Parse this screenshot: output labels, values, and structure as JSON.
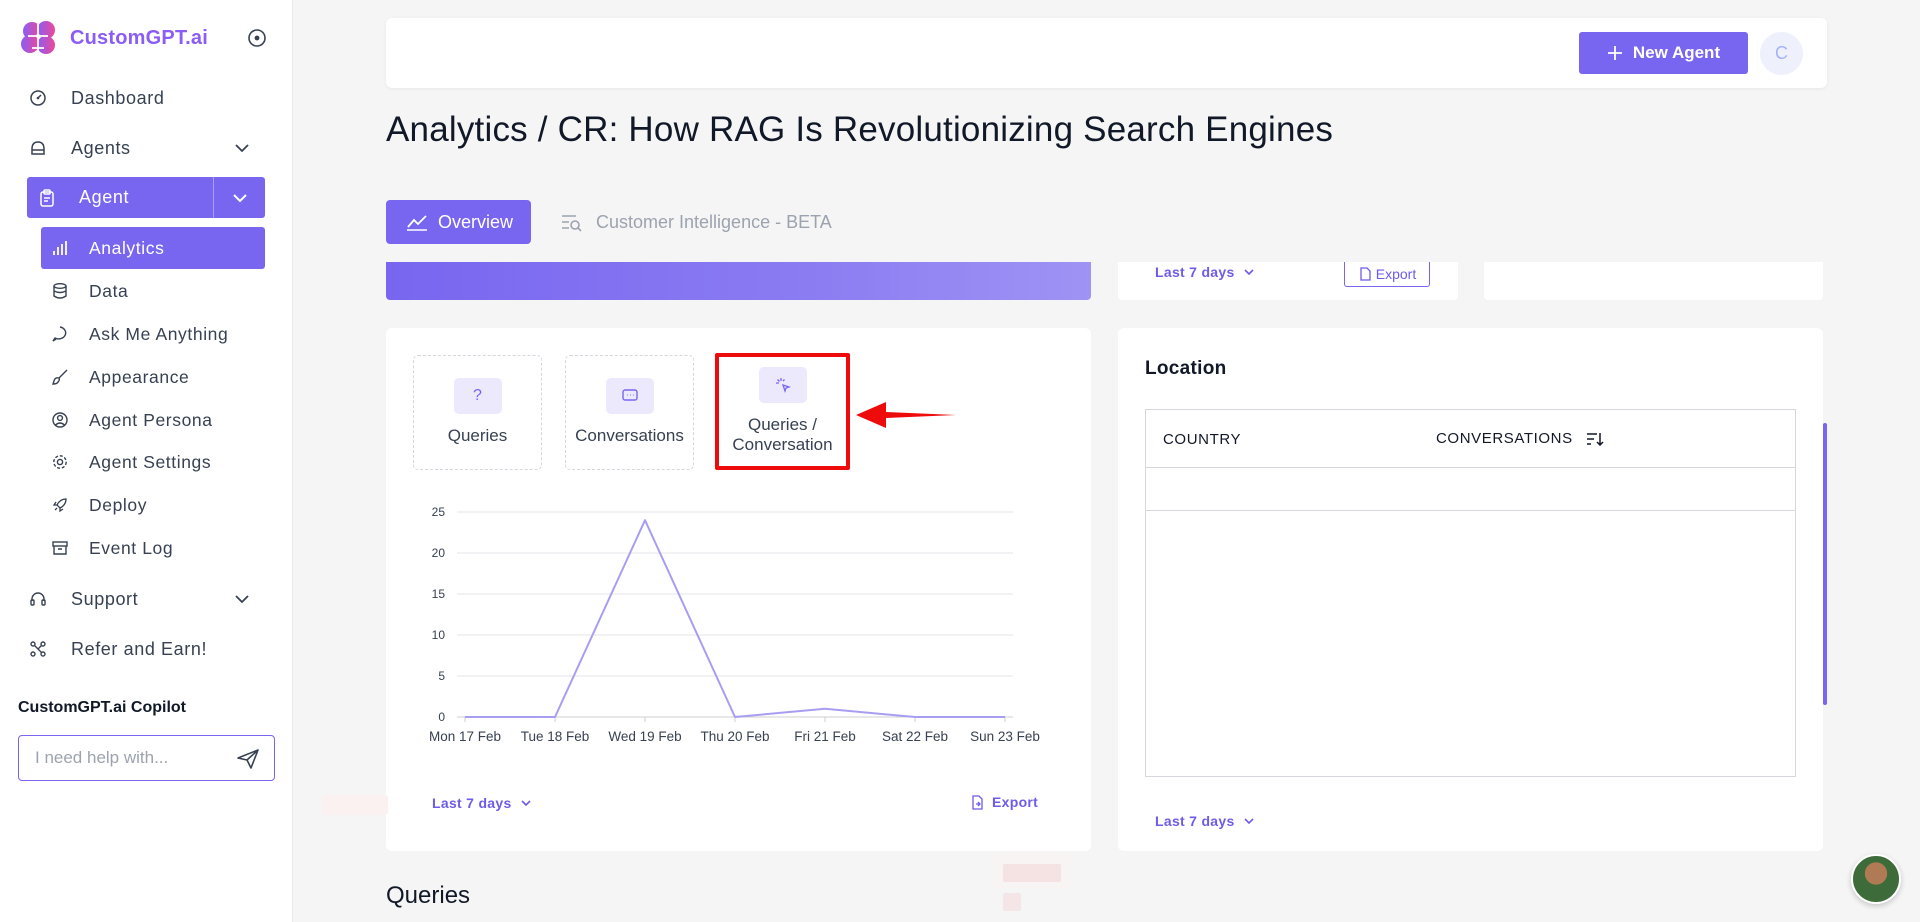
{
  "brand": {
    "name": "CustomGPT.ai"
  },
  "sidebar": {
    "top_items": [
      {
        "label": "Dashboard",
        "icon": "dashboard-icon"
      },
      {
        "label": "Agents",
        "icon": "agents-icon"
      }
    ],
    "agent_label": "Agent",
    "sub_items": [
      {
        "label": "Analytics",
        "icon": "analytics-icon",
        "active": true
      },
      {
        "label": "Data",
        "icon": "database-icon"
      },
      {
        "label": "Ask Me Anything",
        "icon": "chat-icon"
      },
      {
        "label": "Appearance",
        "icon": "brush-icon"
      },
      {
        "label": "Agent Persona",
        "icon": "persona-icon"
      },
      {
        "label": "Agent Settings",
        "icon": "gear-icon"
      },
      {
        "label": "Deploy",
        "icon": "rocket-icon"
      },
      {
        "label": "Event Log",
        "icon": "archive-icon"
      }
    ],
    "bottom_items": [
      {
        "label": "Support",
        "icon": "headset-icon"
      },
      {
        "label": "Refer and Earn!",
        "icon": "share-icon"
      }
    ],
    "copilot": {
      "title": "CustomGPT.ai Copilot",
      "placeholder": "I need help with..."
    }
  },
  "header": {
    "new_agent_label": "New Agent",
    "avatar_letter": "C"
  },
  "page": {
    "title": "Analytics / CR: How RAG Is Revolutionizing Search Engines",
    "tabs": {
      "overview": "Overview",
      "customer_intelligence": "Customer Intelligence - BETA"
    }
  },
  "top_row": {
    "range_label": "Last 7 days",
    "export_label": "Export"
  },
  "chart_card": {
    "metrics": [
      {
        "label": "Queries",
        "icon": "question-icon"
      },
      {
        "label": "Conversations",
        "icon": "message-icon"
      },
      {
        "label": "Queries / Conversation",
        "line1": "Queries /",
        "line2": "Conversation",
        "icon": "cursor-click-icon",
        "selected": true
      }
    ],
    "range_label": "Last 7 days",
    "export_label": "Export"
  },
  "chart_data": {
    "type": "line",
    "x": [
      "Mon 17 Feb",
      "Tue 18 Feb",
      "Wed 19 Feb",
      "Thu 20 Feb",
      "Fri 21 Feb",
      "Sat 22 Feb",
      "Sun 23 Feb"
    ],
    "series": [
      {
        "values": [
          0,
          0,
          24,
          0,
          1,
          0,
          0
        ]
      }
    ],
    "yticks": [
      "0",
      "5",
      "10",
      "15",
      "20",
      "25"
    ],
    "ylim": [
      0,
      25
    ],
    "grid": true,
    "line_color": "#a79ef2",
    "title": "",
    "xlabel": "",
    "ylabel": ""
  },
  "location": {
    "title": "Location",
    "col_country": "COUNTRY",
    "col_conversations": "CONVERSATIONS",
    "range_label": "Last 7 days"
  },
  "section_queries": "Queries",
  "colors": {
    "accent": "#7866f0",
    "highlight": "#ee0b0b"
  }
}
